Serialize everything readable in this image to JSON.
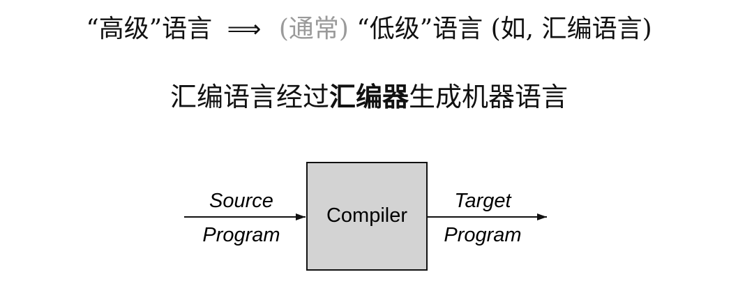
{
  "line1": {
    "high_level": "“高级”语言",
    "arrow": "⟹",
    "usually": "(通常)",
    "low_level": "“低级”语言",
    "example": "(如, 汇编语言)"
  },
  "line2": {
    "before": "汇编语言经过",
    "bold": "汇编器",
    "after": "生成机器语言"
  },
  "diagram": {
    "input_top": "Source",
    "input_bottom": "Program",
    "box_label": "Compiler",
    "output_top": "Target",
    "output_bottom": "Program",
    "box_fill": "#d3d3d3"
  }
}
